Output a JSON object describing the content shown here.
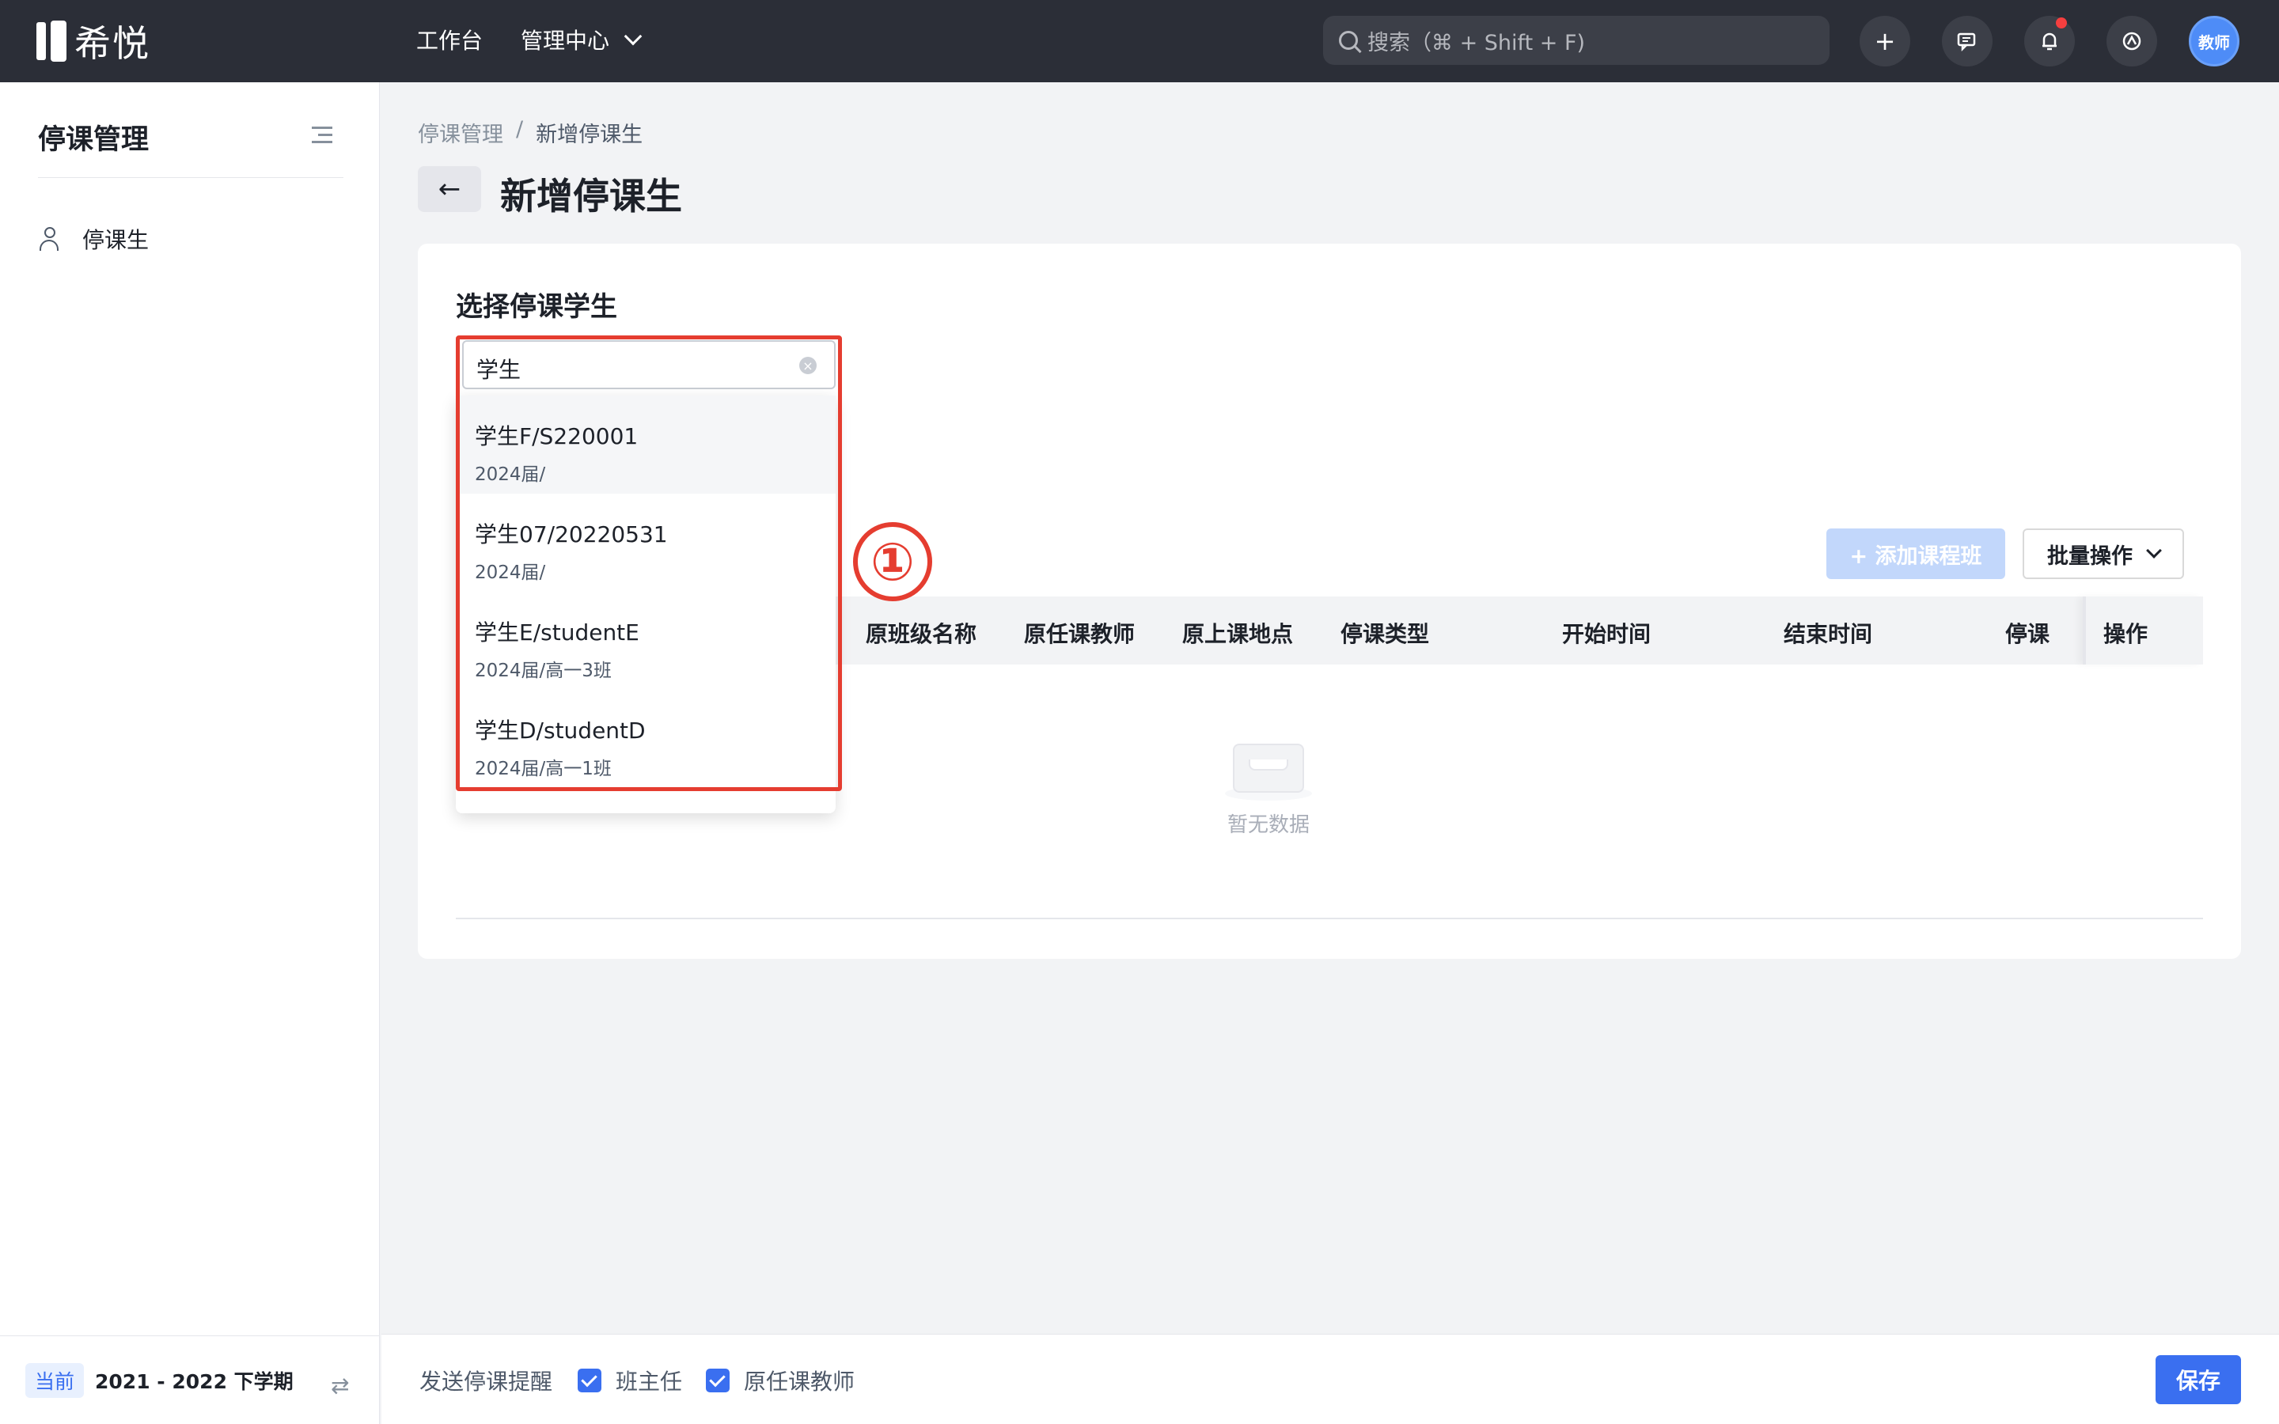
{
  "app": {
    "logo_text": "希悦"
  },
  "topnav": {
    "workbench": "工作台",
    "admin_center": "管理中心",
    "search_placeholder": "搜索（⌘ + Shift + F)",
    "avatar_text": "教师"
  },
  "sidebar": {
    "title": "停课管理",
    "items": [
      {
        "label": "停课生",
        "icon": "user-clock-icon"
      }
    ],
    "term_tag": "当前",
    "term_text": "2021 - 2022 下学期"
  },
  "breadcrumb": {
    "parent": "停课管理",
    "separator": "/",
    "current": "新增停课生"
  },
  "page": {
    "title": "新增停课生"
  },
  "card": {
    "section_title": "选择停课学生",
    "search_value": "学生",
    "add_button": "+ 添加课程班",
    "batch_button": "批量操作",
    "table_headers": [
      "原班级名称",
      "原任课教师",
      "原上课地点",
      "停课类型",
      "开始时间",
      "结束时间",
      "停课",
      "操作"
    ],
    "empty_text": "暂无数据"
  },
  "dropdown": {
    "options": [
      {
        "name": "学生F/S220001",
        "sub": "2024届/"
      },
      {
        "name": "学生07/20220531",
        "sub": "2024届/"
      },
      {
        "name": "学生E/studentE",
        "sub": "2024届/高一3班"
      },
      {
        "name": "学生D/studentD",
        "sub": "2024届/高一1班"
      }
    ]
  },
  "annotation": {
    "step": "①",
    "color": "#e53d30"
  },
  "bottombar": {
    "label": "发送停课提醒",
    "checkboxes": [
      {
        "label": "班主任",
        "checked": true
      },
      {
        "label": "原任课教师",
        "checked": true
      }
    ],
    "save": "保存"
  },
  "colors": {
    "primary": "#3a6ff0",
    "topbar": "#2b2e37",
    "accent_red": "#f53f3f"
  }
}
